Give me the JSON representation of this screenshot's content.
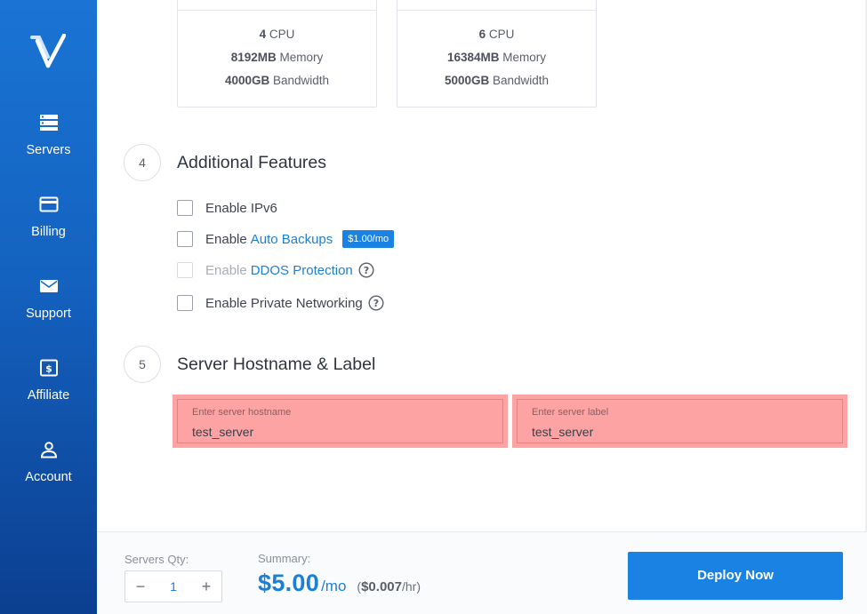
{
  "sidebar": {
    "items": [
      {
        "label": "Servers",
        "icon": "server-icon"
      },
      {
        "label": "Billing",
        "icon": "credit-card-icon"
      },
      {
        "label": "Support",
        "icon": "envelope-icon"
      },
      {
        "label": "Affiliate",
        "icon": "dollar-icon"
      },
      {
        "label": "Account",
        "icon": "user-icon"
      }
    ]
  },
  "plans": [
    {
      "cpu_value": "4",
      "cpu_unit": "CPU",
      "memory_value": "8192MB",
      "memory_unit": "Memory",
      "bandwidth_value": "4000GB",
      "bandwidth_unit": "Bandwidth"
    },
    {
      "cpu_value": "6",
      "cpu_unit": "CPU",
      "memory_value": "16384MB",
      "memory_unit": "Memory",
      "bandwidth_value": "5000GB",
      "bandwidth_unit": "Bandwidth"
    }
  ],
  "additional_features": {
    "step": "4",
    "title": "Additional Features",
    "ipv6": {
      "label": "Enable IPv6",
      "checked": false
    },
    "backups": {
      "prefix": "Enable",
      "link": "Auto Backups",
      "badge": "$1.00/mo",
      "checked": false
    },
    "ddos": {
      "prefix": "Enable",
      "link": "DDOS Protection",
      "disabled": true
    },
    "private_networking": {
      "label": "Enable Private Networking",
      "checked": false
    }
  },
  "hostname_section": {
    "step": "5",
    "title": "Server Hostname & Label",
    "hostname": {
      "placeholder": "Enter server hostname",
      "value": "test_server"
    },
    "label": {
      "placeholder": "Enter server label",
      "value": "test_server"
    }
  },
  "footer": {
    "qty_label": "Servers Qty:",
    "qty_value": "1",
    "minus": "−",
    "plus": "+",
    "summary_label": "Summary:",
    "price_monthly": "$5.00",
    "per_month": "/mo",
    "hourly_open": "(",
    "price_hourly": "$0.007",
    "hourly_close": "/hr)",
    "deploy_label": "Deploy Now"
  },
  "colors": {
    "accent": "#1a82e2",
    "error_field": "#fda3a4",
    "sidebar_top": "#1a74d4",
    "sidebar_bottom": "#0b3f90"
  }
}
